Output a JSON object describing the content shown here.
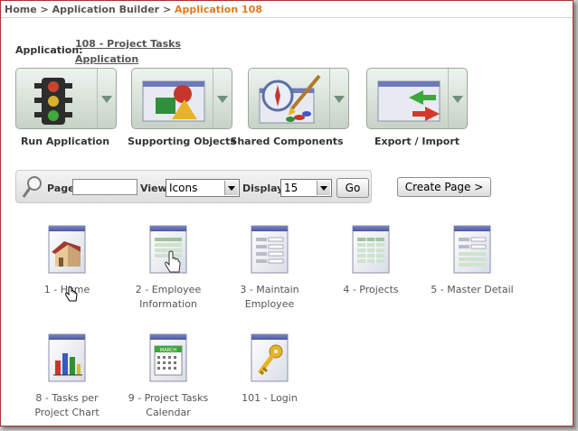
{
  "breadcrumb": {
    "home": "Home",
    "separator1": ">",
    "builder": "Application Builder",
    "separator2": ">",
    "current": "Application 108"
  },
  "application": {
    "label": "Application:",
    "name_line1": "108 - Project Tasks",
    "name_line2": "Application"
  },
  "tiles": [
    {
      "label": "Run Application",
      "icon": "traffic-light-icon"
    },
    {
      "label": "Supporting Objects",
      "icon": "shapes-icon"
    },
    {
      "label": "Shared Components",
      "icon": "compass-brush-icon"
    },
    {
      "label": "Export / Import",
      "icon": "export-import-arrows-icon"
    }
  ],
  "search": {
    "page_label": "Page",
    "page_value": "",
    "view_label": "View",
    "view_value": "Icons",
    "display_label": "Display",
    "display_value": "15",
    "go_label": "Go"
  },
  "create_page_label": "Create Page >",
  "pages": [
    {
      "line1": "1 - Home",
      "line2": "",
      "icon": "house-page-icon"
    },
    {
      "line1": "2 - Employee",
      "line2": "Information",
      "icon": "form-page-icon"
    },
    {
      "line1": "3 - Maintain",
      "line2": "Employee",
      "icon": "form-page-icon"
    },
    {
      "line1": "4 - Projects",
      "line2": "",
      "icon": "report-page-icon"
    },
    {
      "line1": "5 - Master Detail",
      "line2": "",
      "icon": "form-page-icon"
    },
    {
      "line1": "8 - Tasks per",
      "line2": "Project Chart",
      "icon": "chart-page-icon"
    },
    {
      "line1": "9 - Project Tasks",
      "line2": "Calendar",
      "icon": "calendar-page-icon"
    },
    {
      "line1": "101 - Login",
      "line2": "",
      "icon": "key-page-icon"
    }
  ],
  "calendar_month": "MARCH",
  "colors": {
    "accent": "#e07a1f",
    "frame_border": "#a83232"
  }
}
